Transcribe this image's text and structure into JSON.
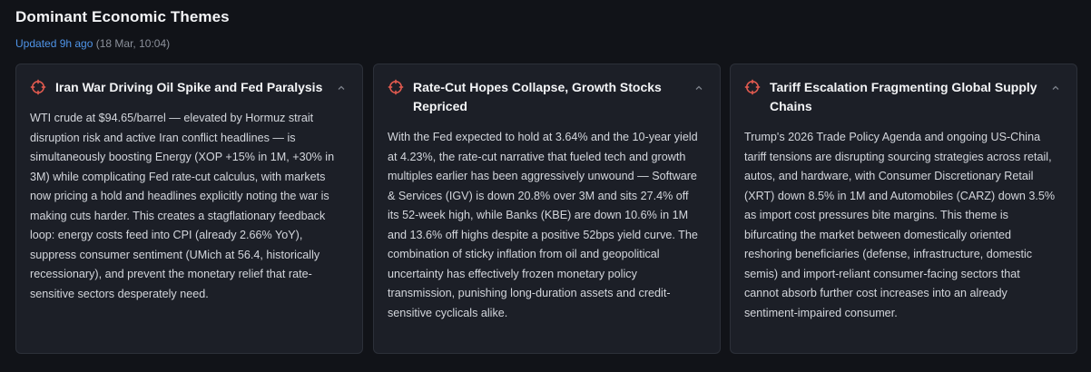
{
  "header": {
    "title": "Dominant Economic Themes",
    "updated_label": "Updated 9h ago",
    "updated_timestamp": "(18 Mar, 10:04)"
  },
  "colors": {
    "accent": "#4f94e8",
    "icon": "#e05a4f",
    "card_bg": "#1c1f27",
    "page_bg": "#111318"
  },
  "cards": [
    {
      "icon": "crosshair-icon",
      "title": "Iran War Driving Oil Spike and Fed Paralysis",
      "body": "WTI crude at $94.65/barrel — elevated by Hormuz strait disruption risk and active Iran conflict headlines — is simultaneously boosting Energy (XOP +15% in 1M, +30% in 3M) while complicating Fed rate-cut calculus, with markets now pricing a hold and headlines explicitly noting the war is making cuts harder. This creates a stagflationary feedback loop: energy costs feed into CPI (already 2.66% YoY), suppress consumer sentiment (UMich at 56.4, historically recessionary), and prevent the monetary relief that rate-sensitive sectors desperately need."
    },
    {
      "icon": "crosshair-icon",
      "title": "Rate-Cut Hopes Collapse, Growth Stocks Repriced",
      "body": "With the Fed expected to hold at 3.64% and the 10-year yield at 4.23%, the rate-cut narrative that fueled tech and growth multiples earlier has been aggressively unwound — Software & Services (IGV) is down 20.8% over 3M and sits 27.4% off its 52-week high, while Banks (KBE) are down 10.6% in 1M and 13.6% off highs despite a positive 52bps yield curve. The combination of sticky inflation from oil and geopolitical uncertainty has effectively frozen monetary policy transmission, punishing long-duration assets and credit-sensitive cyclicals alike."
    },
    {
      "icon": "crosshair-icon",
      "title": "Tariff Escalation Fragmenting Global Supply Chains",
      "body": "Trump's 2026 Trade Policy Agenda and ongoing US-China tariff tensions are disrupting sourcing strategies across retail, autos, and hardware, with Consumer Discretionary Retail (XRT) down 8.5% in 1M and Automobiles (CARZ) down 3.5% as import cost pressures bite margins. This theme is bifurcating the market between domestically oriented reshoring beneficiaries (defense, infrastructure, domestic semis) and import-reliant consumer-facing sectors that cannot absorb further cost increases into an already sentiment-impaired consumer."
    }
  ]
}
